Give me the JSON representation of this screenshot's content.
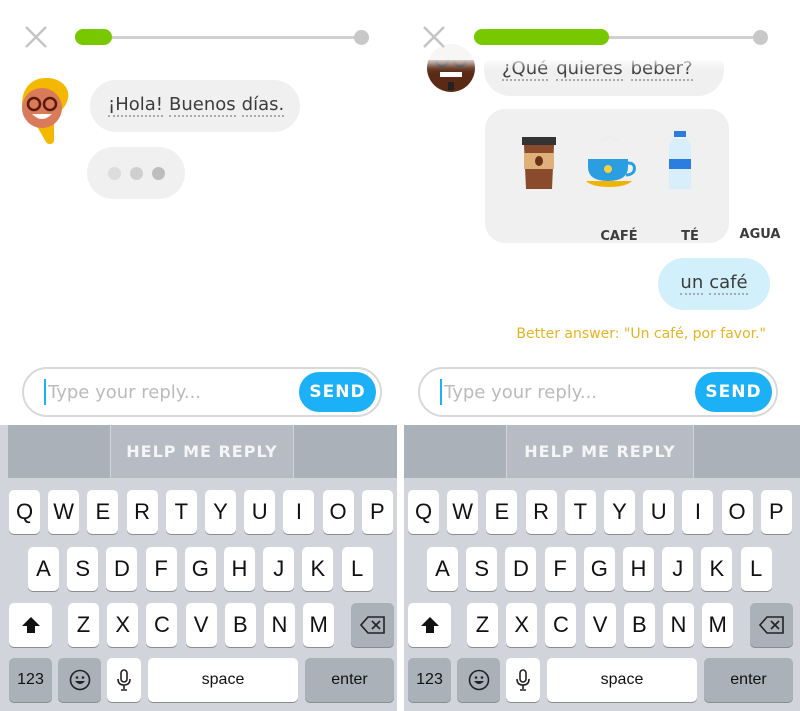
{
  "colors": {
    "accent": "#1cb0f6",
    "progress": "#78c800",
    "better_answer": "#e6b422",
    "user_bubble": "#d2f0fc"
  },
  "screens": [
    {
      "progress_percent": 13,
      "close_icon": "close-x",
      "messages": {
        "bot": [
          "¡Hola!",
          "Buenos",
          "días."
        ],
        "typing_dots": 3
      },
      "input": {
        "placeholder": "Type your reply...",
        "value": "",
        "send_label": "SEND"
      },
      "help_label": "HELP ME REPLY"
    },
    {
      "progress_percent": 47,
      "close_icon": "close-x",
      "messages": {
        "bot": [
          "¿Qué",
          "quieres",
          "beber?"
        ],
        "choices": [
          {
            "label": "CAFÉ",
            "icon": "coffee-cup"
          },
          {
            "label": "TÉ",
            "icon": "tea-cup"
          },
          {
            "label": "AGUA",
            "icon": "water-bottle"
          }
        ],
        "user": [
          "un",
          "café"
        ],
        "better_answer": "Better answer: \"Un café, por favor.\""
      },
      "input": {
        "placeholder": "Type your reply...",
        "value": "",
        "send_label": "SEND"
      },
      "help_label": "HELP ME REPLY"
    }
  ],
  "keyboard": {
    "rows": [
      [
        "Q",
        "W",
        "E",
        "R",
        "T",
        "Y",
        "U",
        "I",
        "O",
        "P"
      ],
      [
        "A",
        "S",
        "D",
        "F",
        "G",
        "H",
        "J",
        "K",
        "L"
      ],
      [
        "Z",
        "X",
        "C",
        "V",
        "B",
        "N",
        "M"
      ]
    ],
    "numbers": "123",
    "space": "space",
    "enter": "enter"
  }
}
